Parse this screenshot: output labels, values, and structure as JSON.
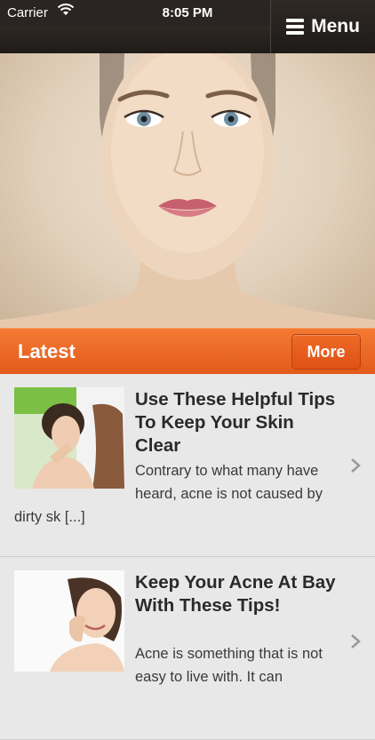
{
  "status_bar": {
    "carrier": "Carrier",
    "time": "8:05 PM"
  },
  "nav": {
    "menu_label": "Menu"
  },
  "hero": {
    "image": "woman-face-portrait"
  },
  "latest": {
    "title": "Latest",
    "more_label": "More"
  },
  "articles": [
    {
      "title": "Use These Helpful Tips To Keep Your Skin Clear",
      "excerpt": "Contrary to what many have heard, acne is not caused by dirty sk [...]",
      "thumbnail": "woman-acne-mirror"
    },
    {
      "title": "Keep Your Acne At Bay With These Tips!",
      "excerpt": "Acne is something that is not easy to live with. It can",
      "thumbnail": "woman-touching-face"
    }
  ],
  "colors": {
    "accent": "#e9631f",
    "nav": "#2a2522",
    "background": "#e8e8e8"
  }
}
